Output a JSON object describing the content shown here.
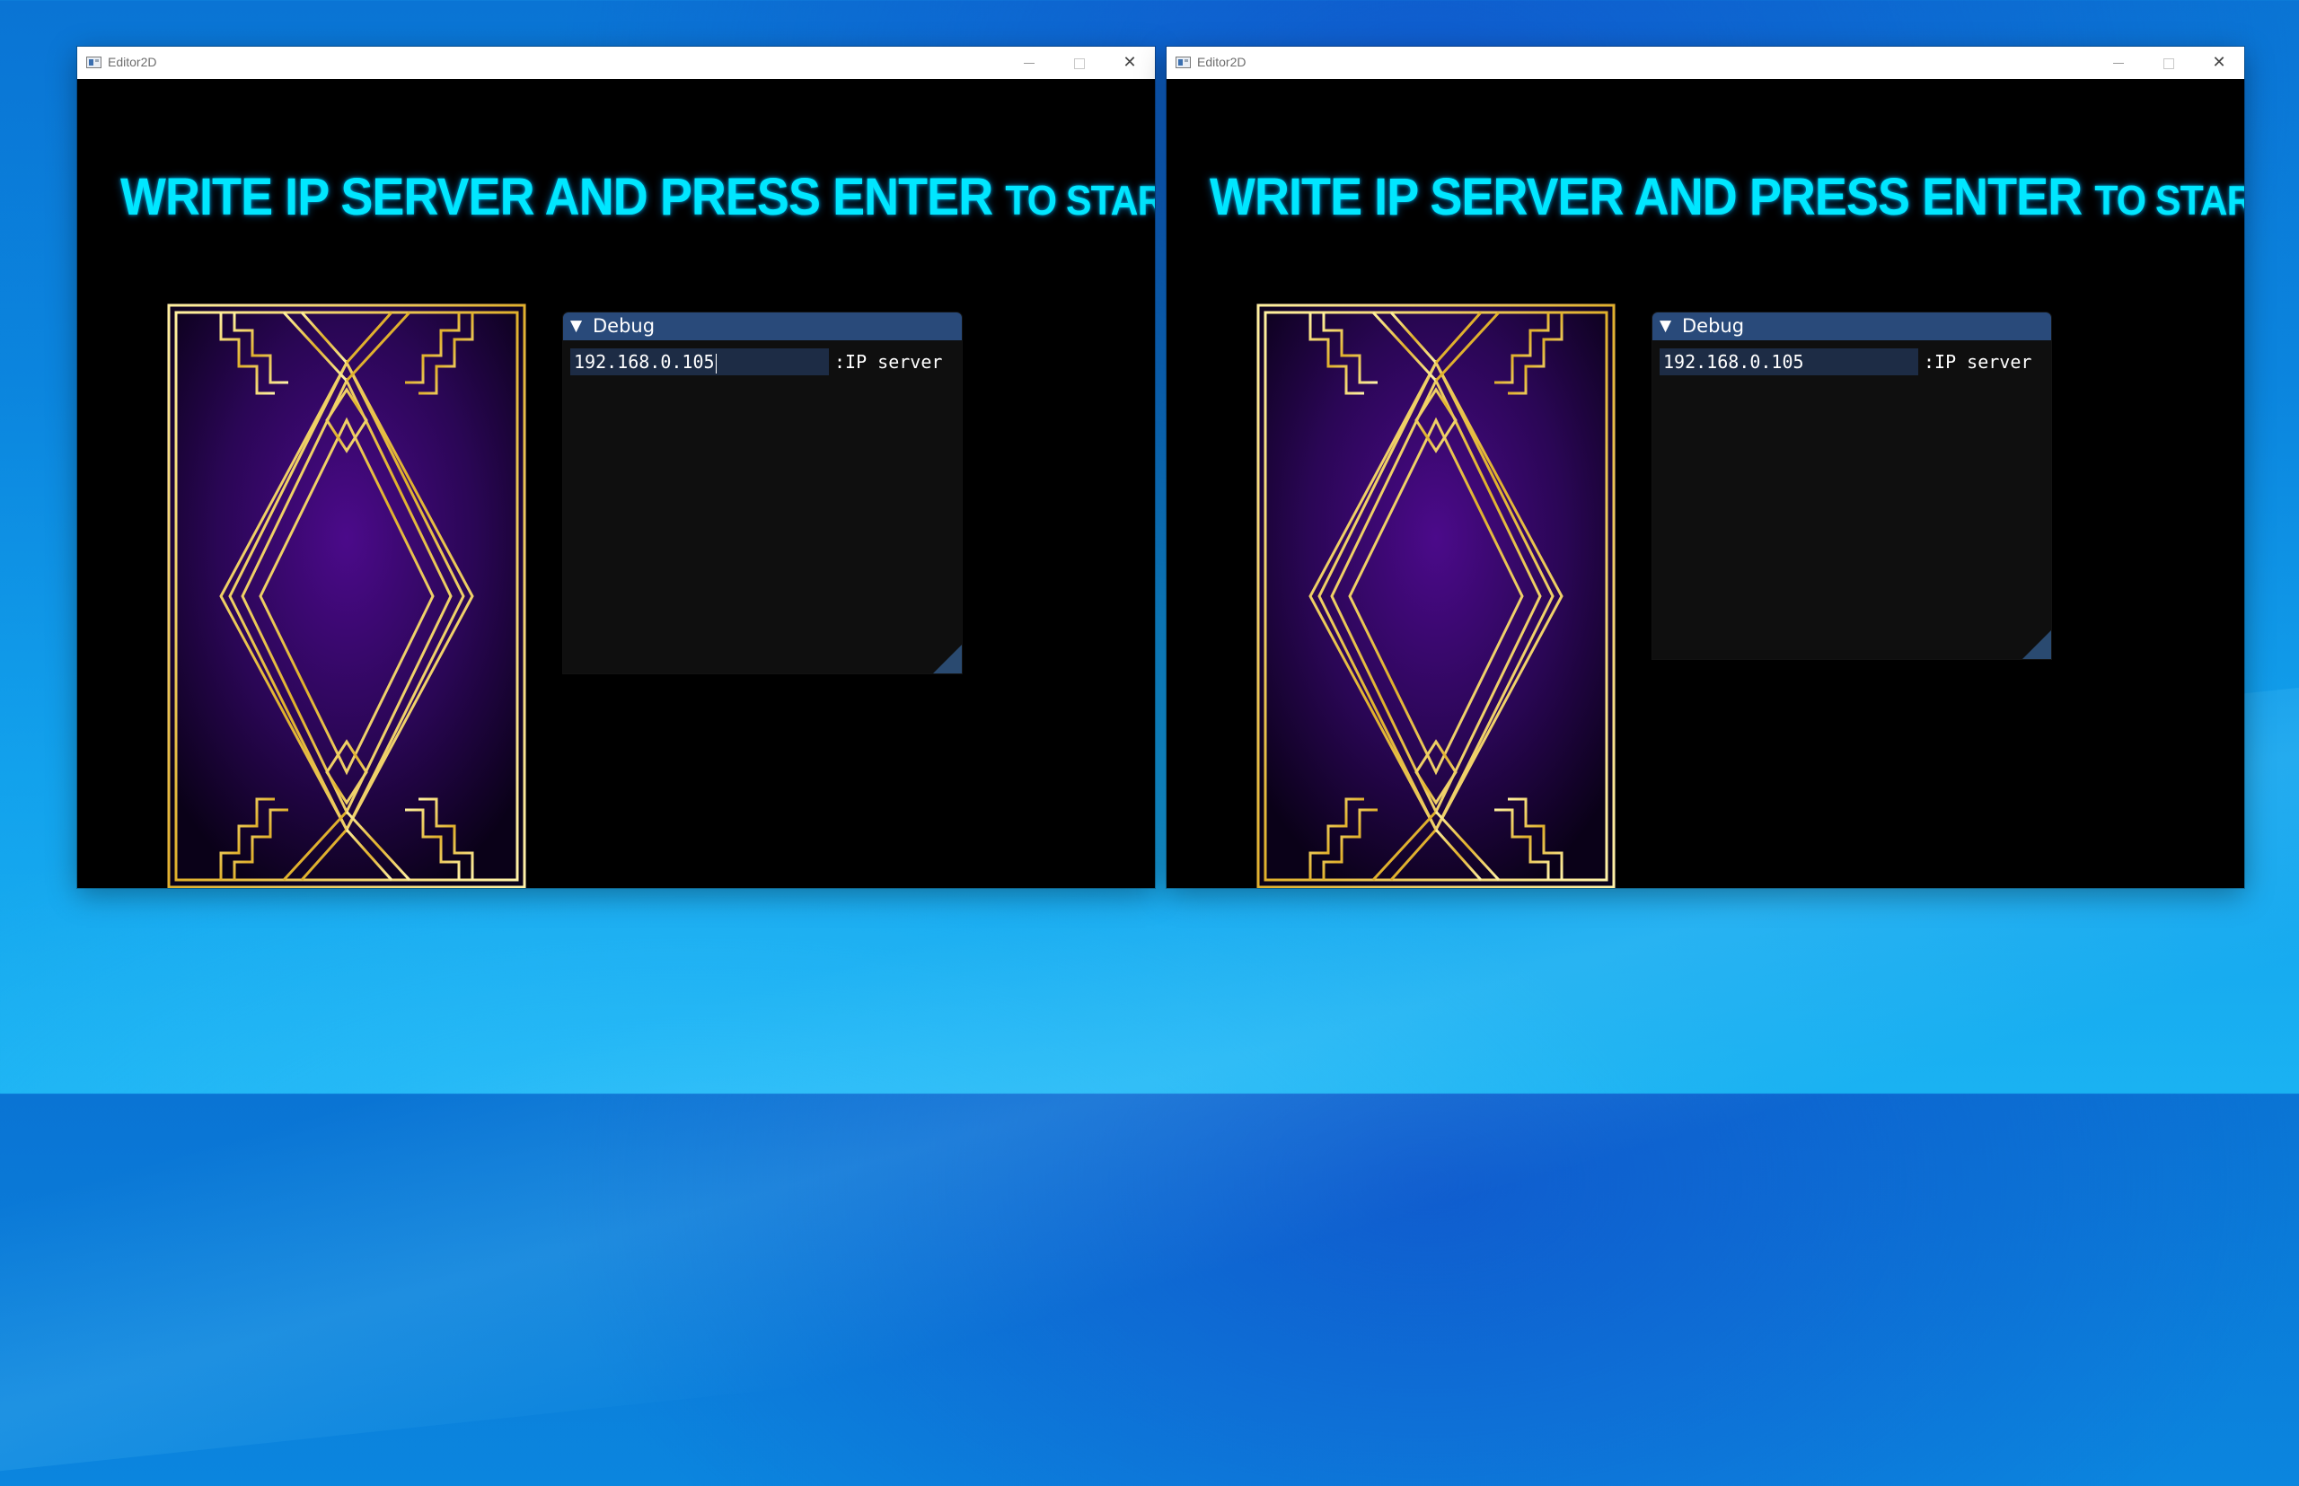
{
  "colors": {
    "headline": "#00e6ff",
    "debug_title_bg": "#294a7a",
    "debug_input_bg": "#1d2c45",
    "card_gold": "#f3d04a",
    "card_purple": "#4b0a8a"
  },
  "windows": [
    {
      "title": "Editor2D",
      "headline_main": "WRITE IP SERVER AND PRESS ENTER",
      "headline_tail": "TO START",
      "debug": {
        "title": "Debug",
        "ip_value": "192.168.0.105",
        "ip_label": ":IP server",
        "focused": true
      }
    },
    {
      "title": "Editor2D",
      "headline_main": "WRITE IP SERVER AND PRESS ENTER",
      "headline_tail": "TO START",
      "debug": {
        "title": "Debug",
        "ip_value": "192.168.0.105",
        "ip_label": ":IP server",
        "focused": false
      }
    }
  ],
  "icons": {
    "app": "app-window-icon",
    "minimize": "minimize-icon",
    "maximize": "maximize-icon",
    "close": "close-icon",
    "collapse": "collapse-triangle-icon",
    "resize": "resize-grip-icon"
  }
}
